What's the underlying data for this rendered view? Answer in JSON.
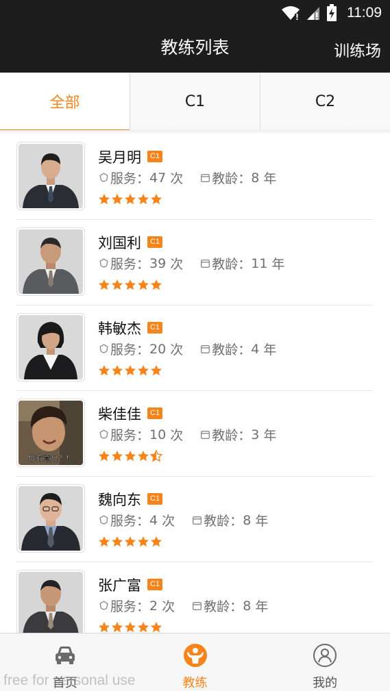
{
  "status_bar": {
    "time": "11:09"
  },
  "app_bar": {
    "title": "教练列表",
    "action": "训练场"
  },
  "tabs": [
    {
      "label": "全部",
      "active": true
    },
    {
      "label": "C1",
      "active": false
    },
    {
      "label": "C2",
      "active": false
    }
  ],
  "stats_labels": {
    "service": "服务：",
    "unit_times": "次",
    "experience": "教龄：",
    "unit_years": "年"
  },
  "coaches": [
    {
      "name": "吴月明",
      "license": "C1",
      "service_count": "47",
      "experience_years": "8",
      "rating": 5
    },
    {
      "name": "刘国利",
      "license": "C1",
      "service_count": "39",
      "experience_years": "11",
      "rating": 5
    },
    {
      "name": "韩敏杰",
      "license": "C1",
      "service_count": "20",
      "experience_years": "4",
      "rating": 5
    },
    {
      "name": "柴佳佳",
      "license": "C1",
      "service_count": "10",
      "experience_years": "3",
      "rating": 4.5,
      "photo_caption": "你有意见？！"
    },
    {
      "name": "魏向东",
      "license": "C1",
      "service_count": "4",
      "experience_years": "8",
      "rating": 5
    },
    {
      "name": "张广富",
      "license": "C1",
      "service_count": "2",
      "experience_years": "8",
      "rating": 5
    }
  ],
  "bottom_nav": [
    {
      "label": "首页",
      "icon": "car-icon",
      "active": false
    },
    {
      "label": "教练",
      "icon": "coach-icon",
      "active": true
    },
    {
      "label": "我的",
      "icon": "profile-icon",
      "active": false
    }
  ],
  "watermark": "free for personal use",
  "colors": {
    "accent": "#f7841b",
    "bar": "#1d1d1d"
  }
}
